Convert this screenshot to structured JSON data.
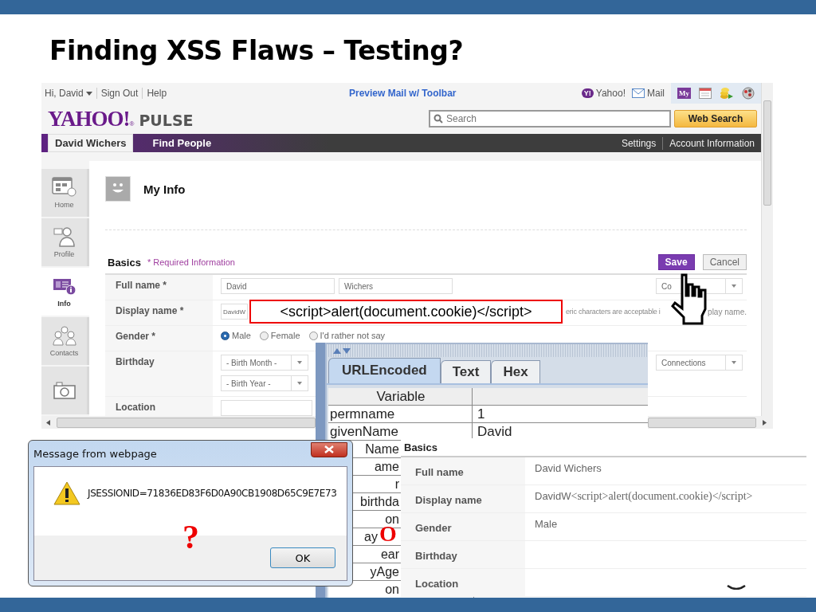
{
  "slide": {
    "title": "Finding XSS Flaws – Testing?",
    "question_mark": "?",
    "partial_word": "O"
  },
  "browser": {
    "account": {
      "greeting": "Hi, David",
      "links": [
        "Sign Out",
        "Help"
      ]
    },
    "toolbar_link": "Preview Mail w/ Toolbar",
    "shortcuts": [
      {
        "kind": "yahoo",
        "badge": "Y!",
        "label": "Yahoo!"
      },
      {
        "kind": "mail",
        "label": "Mail"
      }
    ],
    "toolbar_badge": "My",
    "logo": {
      "brand": "YAHOO!",
      "mark": "®",
      "product": "PULSE"
    },
    "search": {
      "placeholder": "Search",
      "button": "Web Search"
    },
    "nav": {
      "tabs": [
        {
          "label": "David Wichers",
          "selected": true
        },
        {
          "label": "Find People",
          "selected": false
        }
      ],
      "links": [
        "Settings",
        "Account Information"
      ]
    },
    "sidebar": [
      {
        "label": "Home",
        "selected": false
      },
      {
        "label": "Profile",
        "selected": false
      },
      {
        "label": "Info",
        "selected": true
      },
      {
        "label": "Contacts",
        "selected": false
      },
      {
        "selected": false
      }
    ],
    "form": {
      "heading": "My Info",
      "section": "Basics",
      "required_note": "* Required Information",
      "buttons": [
        {
          "label": "Save",
          "kind": "primary"
        },
        {
          "label": "Cancel",
          "kind": "secondary"
        }
      ],
      "rows": [
        {
          "kind": "name",
          "label": "Full name *",
          "values": [
            "David",
            "Wichers"
          ],
          "side_select": "Co"
        },
        {
          "kind": "display",
          "label": "Display name *",
          "value": "DavidW",
          "hint": "eric characters are acceptable i",
          "hint_end": "play name."
        },
        {
          "kind": "radio",
          "label": "Gender *",
          "options": [
            {
              "label": "Male",
              "selected": true
            },
            {
              "label": "Female",
              "selected": false
            },
            {
              "label": "I'd rather not say",
              "selected": false
            }
          ]
        },
        {
          "kind": "birthday",
          "label": "Birthday",
          "selects": [
            "- Birth Month -",
            "- Birth Year -"
          ],
          "side_select": "Connections"
        },
        {
          "kind": "text",
          "label": "Location"
        }
      ]
    }
  },
  "callout": "<script>alert(document.cookie)</script>",
  "tamper": {
    "tabs": [
      {
        "label": "URLEncoded",
        "selected": true
      },
      {
        "label": "Text",
        "selected": false
      },
      {
        "label": "Hex",
        "selected": false
      }
    ],
    "header": "Variable",
    "rows": [
      {
        "name": "permname",
        "value": "1"
      },
      {
        "name": "givenName",
        "value": "David"
      },
      {
        "name": "Name"
      },
      {
        "name": "ame"
      },
      {
        "name": "r"
      },
      {
        "name": "birthda"
      },
      {
        "name": "on"
      },
      {
        "name": "ay"
      },
      {
        "name": "ear"
      },
      {
        "name": "yAge"
      },
      {
        "name": "on"
      }
    ]
  },
  "result": {
    "heading": "Basics",
    "rows": [
      {
        "label": "Full name",
        "value": "David Wichers"
      },
      {
        "label": "Display name",
        "value": "DavidW",
        "injected": "<script>alert(document.cookie)</script>"
      },
      {
        "label": "Gender",
        "value": "Male"
      },
      {
        "label": "Birthday"
      },
      {
        "label": "Location"
      }
    ]
  },
  "dialog": {
    "title": "Message from webpage",
    "message": "JSESSIONID=71836ED83F6D0A90CB1908D65C9E7E73",
    "button": "OK"
  }
}
